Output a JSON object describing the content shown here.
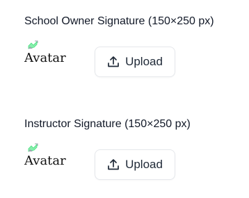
{
  "owner_signature": {
    "title": "School Owner Signature (150×250 px)",
    "avatar_alt": "Avatar",
    "upload_label": "Upload",
    "upload_icon": "upload-icon",
    "broken_image_icon": "broken-image-icon"
  },
  "instructor_signature": {
    "title": "Instructor Signature (150×250 px)",
    "avatar_alt": "Avatar",
    "upload_label": "Upload",
    "upload_icon": "upload-icon",
    "broken_image_icon": "broken-image-icon"
  },
  "colors": {
    "text": "#111827",
    "button_border": "#e5e7eb",
    "icon_green": "#4ade80"
  }
}
